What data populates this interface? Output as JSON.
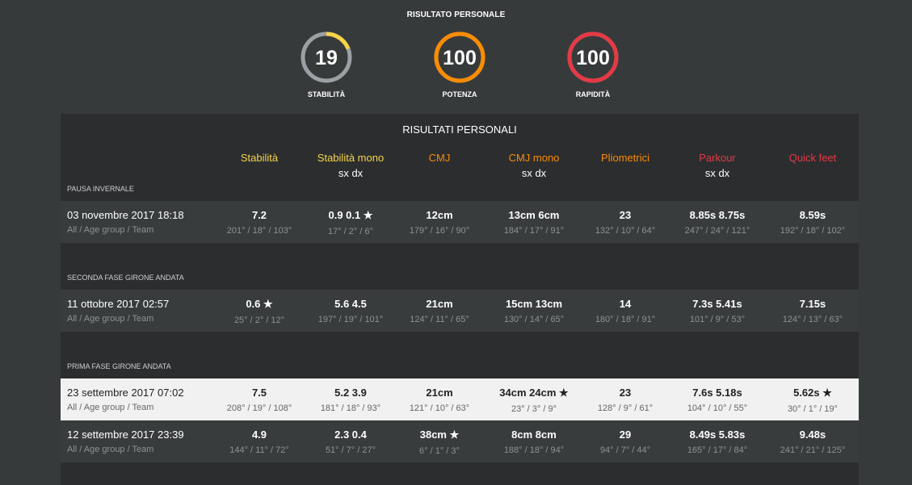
{
  "header": {
    "title": "RISULTATO PERSONALE"
  },
  "gauges": [
    {
      "value": "19",
      "label": "STABILITÀ",
      "color": "#f5d547",
      "fraction": 0.19
    },
    {
      "value": "100",
      "label": "POTENZA",
      "color": "#fb8c00",
      "fraction": 1
    },
    {
      "value": "100",
      "label": "RAPIDITÀ",
      "color": "#e53945",
      "fraction": 1
    }
  ],
  "panel": {
    "title": "RISULTATI PERSONALI"
  },
  "columns": [
    {
      "label": "Stabilità",
      "sub": "",
      "color": "#f5d547"
    },
    {
      "label": "Stabilità mono",
      "sub": "sx dx",
      "color": "#f5d547"
    },
    {
      "label": "CMJ",
      "sub": "",
      "color": "#fb8c00"
    },
    {
      "label": "CMJ mono",
      "sub": "sx dx",
      "color": "#fb8c00"
    },
    {
      "label": "Pliometrici",
      "sub": "",
      "color": "#fb8c00"
    },
    {
      "label": "Parkour",
      "sub": "sx dx",
      "color": "#e53945"
    },
    {
      "label": "Quick feet",
      "sub": "",
      "color": "#e53945"
    }
  ],
  "sections": [
    {
      "title": "PAUSA INVERNALE",
      "rows": [
        {
          "date": "03 novembre 2017 18:18",
          "group": "All / Age group / Team",
          "highlight": false,
          "cells": [
            {
              "v": "7.2",
              "a": "201° / 18° / 103°"
            },
            {
              "v": "0.9 0.1 ★",
              "a": "17° / 2° / 6°"
            },
            {
              "v": "12cm",
              "a": "179° / 16° / 90°"
            },
            {
              "v": "13cm 6cm",
              "a": "184° / 17° / 91°"
            },
            {
              "v": "23",
              "a": "132° / 10° / 64°"
            },
            {
              "v": "8.85s 8.75s",
              "a": "247° / 24° / 121°"
            },
            {
              "v": "8.59s",
              "a": "192° / 18° / 102°"
            }
          ]
        }
      ]
    },
    {
      "title": "SECONDA FASE GIRONE ANDATA",
      "rows": [
        {
          "date": "11 ottobre 2017 02:57",
          "group": "All / Age group / Team",
          "highlight": false,
          "cells": [
            {
              "v": "0.6 ★",
              "a": "25° / 2° / 12°"
            },
            {
              "v": "5.6 4.5",
              "a": "197° / 19° / 101°"
            },
            {
              "v": "21cm",
              "a": "124° / 11° / 65°"
            },
            {
              "v": "15cm 13cm",
              "a": "130° / 14° / 65°"
            },
            {
              "v": "14",
              "a": "180° / 18° / 91°"
            },
            {
              "v": "7.3s 5.41s",
              "a": "101° / 9° / 53°"
            },
            {
              "v": "7.15s",
              "a": "124° / 13° / 63°"
            }
          ]
        }
      ]
    },
    {
      "title": "PRIMA FASE GIRONE ANDATA",
      "rows": [
        {
          "date": "23 settembre 2017 07:02",
          "group": "All / Age group / Team",
          "highlight": true,
          "cells": [
            {
              "v": "7.5",
              "a": "208° / 19° / 108°"
            },
            {
              "v": "5.2 3.9",
              "a": "181° / 18° / 93°"
            },
            {
              "v": "21cm",
              "a": "121° / 10° / 63°"
            },
            {
              "v": "34cm 24cm ★",
              "a": "23° / 3° / 9°"
            },
            {
              "v": "23",
              "a": "128° / 9° / 61°"
            },
            {
              "v": "7.6s 5.18s",
              "a": "104° / 10° / 55°"
            },
            {
              "v": "5.62s ★",
              "a": "30° / 1° / 19°"
            }
          ]
        },
        {
          "date": "12 settembre 2017 23:39",
          "group": "All / Age group / Team",
          "highlight": false,
          "cells": [
            {
              "v": "4.9",
              "a": "144° / 11° / 72°"
            },
            {
              "v": "2.3 0.4",
              "a": "51° / 7° / 27°"
            },
            {
              "v": "38cm ★",
              "a": "6° / 1° / 3°"
            },
            {
              "v": "8cm 8cm",
              "a": "188° / 18° / 94°"
            },
            {
              "v": "29",
              "a": "94° / 7° / 44°"
            },
            {
              "v": "8.49s 5.83s",
              "a": "165° / 17° / 84°"
            },
            {
              "v": "9.48s",
              "a": "241° / 21° / 125°"
            }
          ]
        }
      ]
    }
  ]
}
